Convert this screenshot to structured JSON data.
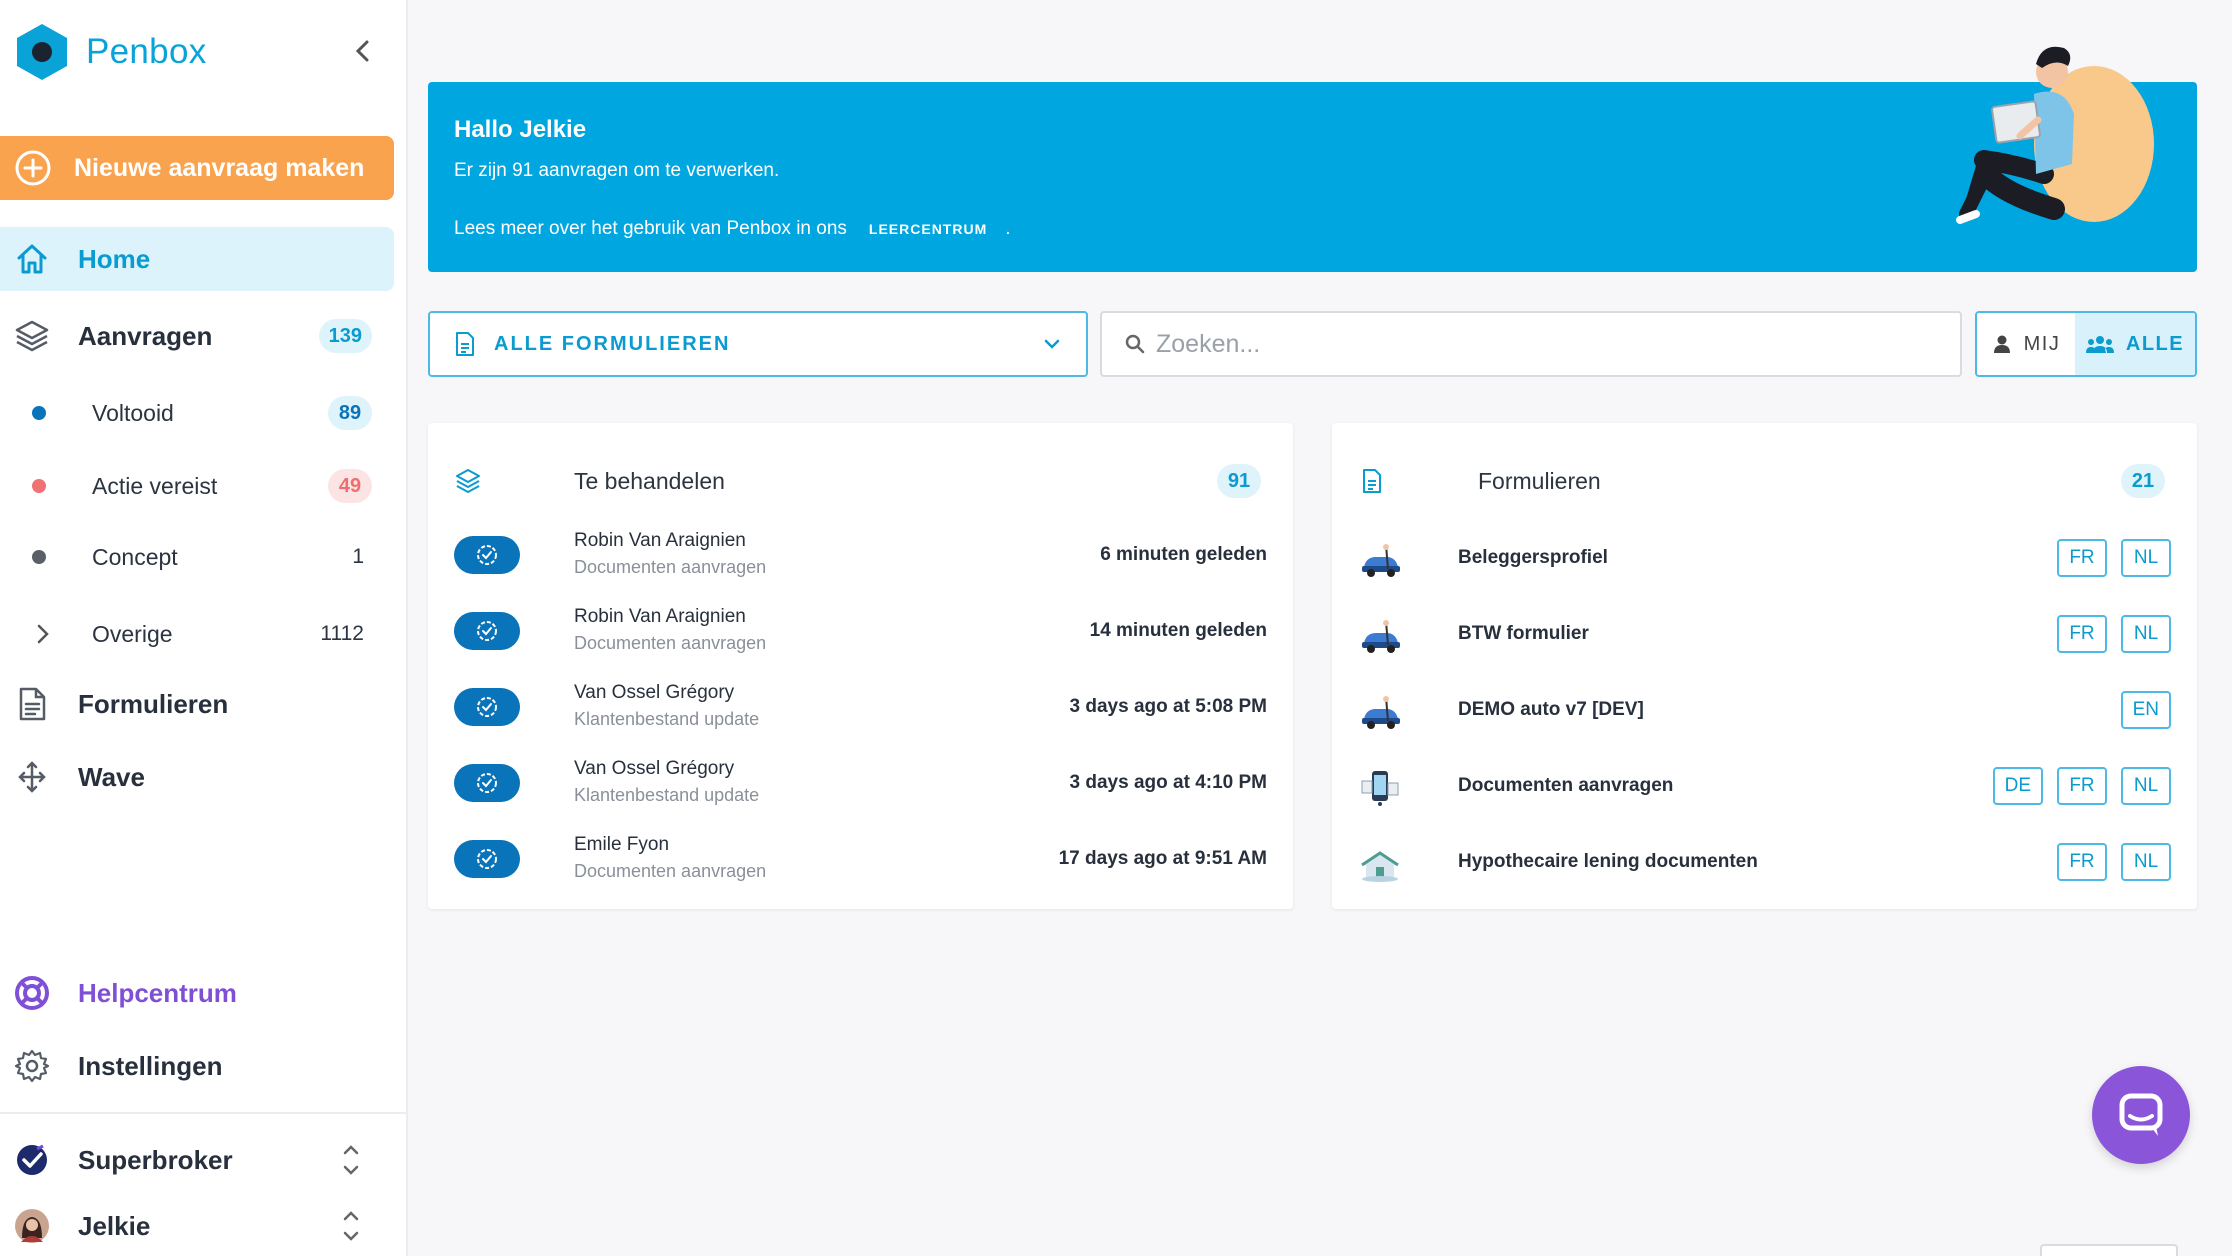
{
  "brand": {
    "name": "Penbox",
    "logo_icon": "penbox-hexagon-logo"
  },
  "sidebar": {
    "new_request_label": "Nieuwe aanvraag maken",
    "home_label": "Home",
    "requests": {
      "label": "Aanvragen",
      "count": "139"
    },
    "sub_items": [
      {
        "label": "Voltooid",
        "count": "89",
        "dot_color": "#0a74bb"
      },
      {
        "label": "Actie vereist",
        "count": "49",
        "dot_color": "#f07272"
      },
      {
        "label": "Concept",
        "count": "1",
        "dot_color": "#5b6068"
      },
      {
        "label": "Overige",
        "count": "1112"
      }
    ],
    "forms_label": "Formulieren",
    "wave_label": "Wave",
    "help_label": "Helpcentrum",
    "settings_label": "Instellingen",
    "org_label": "Superbroker",
    "user_label": "Jelkie"
  },
  "banner": {
    "greeting": "Hallo Jelkie",
    "line1": "Er zijn 91 aanvragen om te verwerken.",
    "line2": "Lees meer over het gebruik van Penbox in ons",
    "link": "LEERCENTRUM",
    "suffix": "."
  },
  "filters": {
    "form_select": "ALLE FORMULIEREN",
    "search_placeholder": "Zoeken...",
    "toggle_me": "MIJ",
    "toggle_all": "ALLE"
  },
  "to_handle": {
    "title": "Te behandelen",
    "count": "91",
    "rows": [
      {
        "name": "Robin Van Araignien",
        "form": "Documenten aanvragen",
        "time": "6 minuten geleden"
      },
      {
        "name": "Robin Van Araignien",
        "form": "Documenten aanvragen",
        "time": "14 minuten geleden"
      },
      {
        "name": "Van Ossel Grégory",
        "form": "Klantenbestand update",
        "time": "3 days ago at 5:08 PM"
      },
      {
        "name": "Van Ossel Grégory",
        "form": "Klantenbestand update",
        "time": "3 days ago at 4:10 PM"
      },
      {
        "name": "Emile Fyon",
        "form": "Documenten aanvragen",
        "time": "17 days ago at 9:51 AM"
      }
    ]
  },
  "forms": {
    "title": "Formulieren",
    "count": "21",
    "rows": [
      {
        "name": "Beleggersprofiel",
        "langs": [
          "FR",
          "NL"
        ]
      },
      {
        "name": "BTW formulier",
        "langs": [
          "FR",
          "NL"
        ]
      },
      {
        "name": "DEMO auto v7 [DEV]",
        "langs": [
          "EN"
        ]
      },
      {
        "name": "Documenten aanvragen",
        "langs": [
          "DE",
          "FR",
          "NL"
        ]
      },
      {
        "name": "Hypothecaire lening documenten",
        "langs": [
          "FR",
          "NL"
        ]
      }
    ]
  },
  "colors": {
    "brand_blue": "#00a6e0",
    "accent_orange": "#f9a34f",
    "chat_purple": "#8a55d9",
    "status_blue": "#0a74bb"
  }
}
